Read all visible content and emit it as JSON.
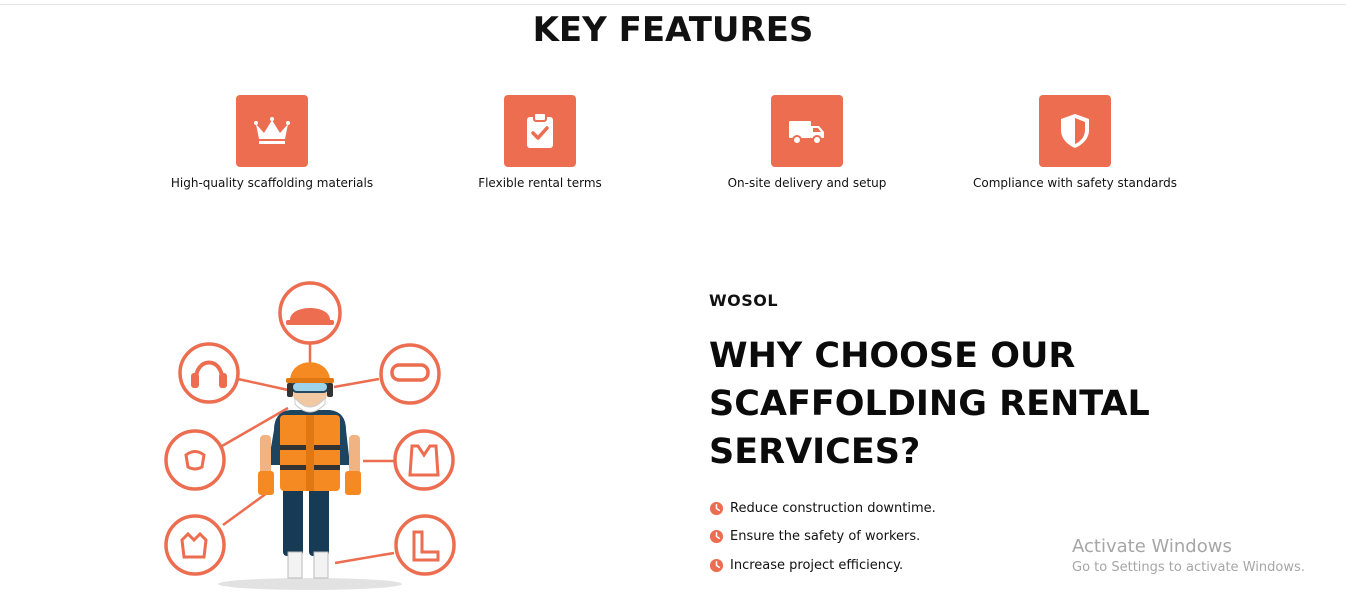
{
  "section": {
    "title": "KEY FEATURES"
  },
  "features": [
    {
      "icon": "crown-icon",
      "label": "High-quality scaffolding materials"
    },
    {
      "icon": "clipboard-check-icon",
      "label": "Flexible rental terms"
    },
    {
      "icon": "delivery-truck-icon",
      "label": "On-site delivery and setup"
    },
    {
      "icon": "shield-icon",
      "label": "Compliance with safety standards"
    }
  ],
  "why": {
    "brand": "WOSOL",
    "headline": "WHY CHOOSE OUR SCAFFOLDING RENTAL SERVICES?",
    "benefits": [
      "Reduce construction downtime.",
      "Ensure the safety of workers.",
      "Increase project efficiency."
    ]
  },
  "watermark": {
    "title": "Activate Windows",
    "subtitle": "Go to Settings to activate Windows."
  },
  "colors": {
    "accent": "#ec6d4f",
    "text": "#111111",
    "watermark": "#a6a6a6"
  }
}
